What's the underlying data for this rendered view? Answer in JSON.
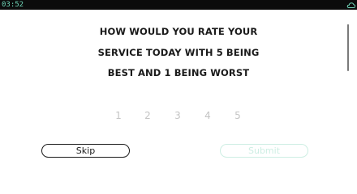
{
  "status_bar": {
    "time": "03:52",
    "right_icon": "cloud-icon"
  },
  "survey": {
    "question_lines": [
      "HOW WOULD YOU RATE YOUR",
      "SERVICE TODAY WITH 5 BEING",
      "BEST AND 1 BEING WORST"
    ],
    "rating_options": [
      "1",
      "2",
      "3",
      "4",
      "5"
    ],
    "selected_rating": null
  },
  "actions": {
    "skip_label": "Skip",
    "submit_label": "Submit",
    "submit_enabled": false
  },
  "colors": {
    "status_bar_bg": "#0b0b0b",
    "status_text": "#6fd3b6",
    "text_primary": "#1a1a1a",
    "rating_inactive": "#c4c4c4",
    "submit_disabled": "#cdeee3"
  }
}
